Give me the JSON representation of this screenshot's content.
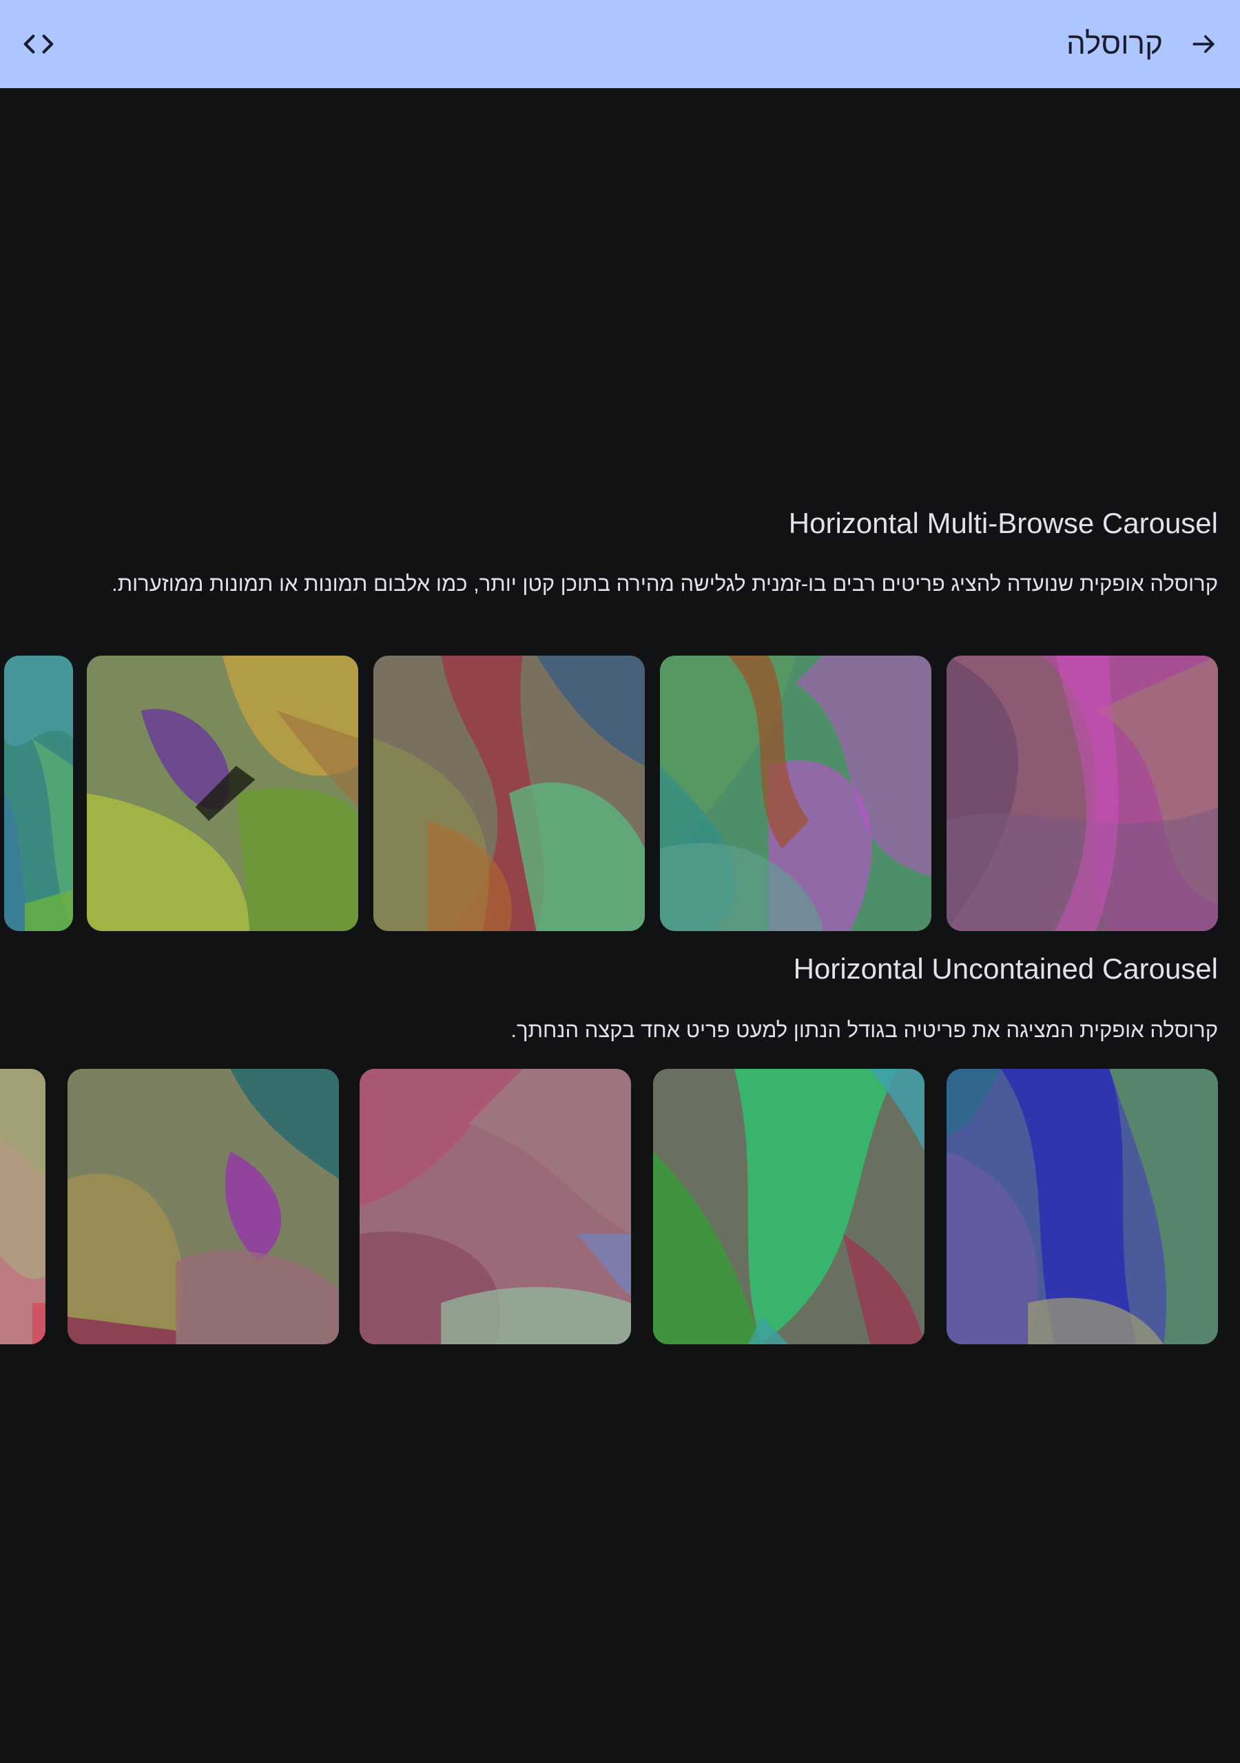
{
  "app_bar": {
    "title": "קרוסלה",
    "back_icon": "arrow-forward-icon",
    "code_icon": "code-icon"
  },
  "sections": [
    {
      "title": "Horizontal Multi-Browse Carousel",
      "description": "קרוסלה אופקית שנועדה להציג פריטים רבים בו-זמנית לגלישה מהירה בתוכן קטן יותר, כמו אלבום תמונות או תמונות ממוזערות."
    },
    {
      "title": "Horizontal Uncontained Carousel",
      "description": "קרוסלה אופקית המציגה את פריטיה בגודל הנתון למעט פריט אחד בקצה הנחתך."
    }
  ],
  "colors": {
    "app_bar_bg": "#adc6ff",
    "background": "#111214",
    "text": "#e3e2e6"
  }
}
